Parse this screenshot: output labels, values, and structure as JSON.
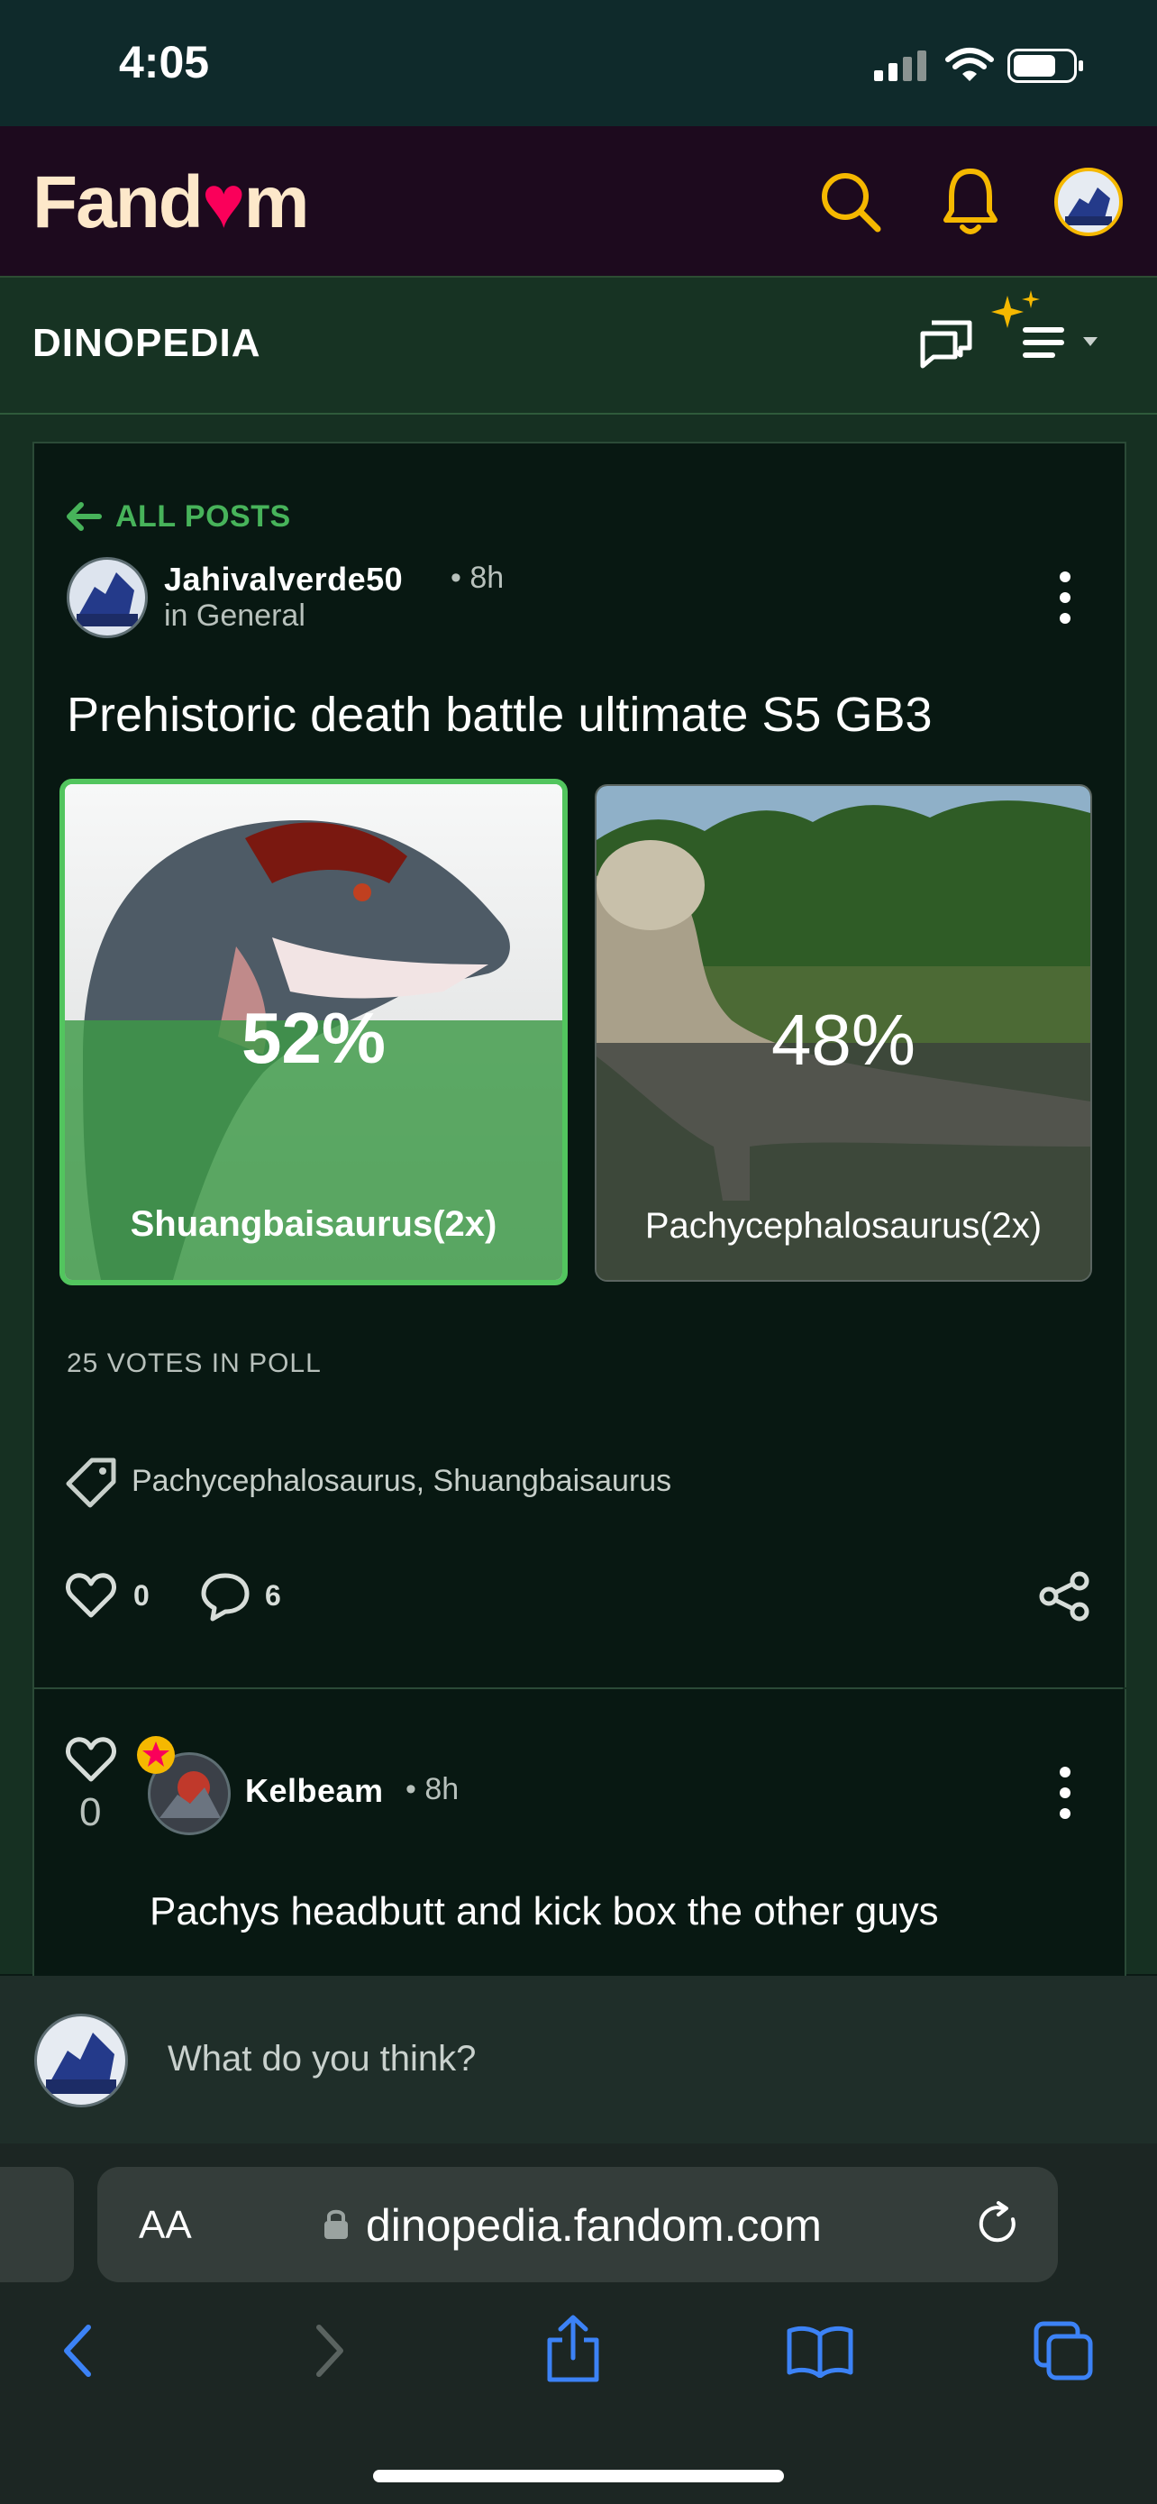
{
  "status_bar": {
    "time": "4:05"
  },
  "header": {
    "logo_text_1": "Fand",
    "logo_text_2": "m"
  },
  "wiki": {
    "name": "DINOPEDIA"
  },
  "post": {
    "back_label": "ALL POSTS",
    "author": "Jahivalverde50",
    "time": "• 8h",
    "category": "in General",
    "title": "Prehistoric death battle ultimate S5 GB3",
    "poll": {
      "options": [
        {
          "label": "Shuangbaisaurus(2x)",
          "percent": "52%",
          "value": 0.52,
          "selected": true
        },
        {
          "label": "Pachycephalosaurus(2x)",
          "percent": "48%",
          "value": 0.48,
          "selected": false
        }
      ],
      "votes_text": "25 VOTES IN POLL"
    },
    "tags": "Pachycephalosaurus, Shuangbaisaurus",
    "likes": "0",
    "comments": "6"
  },
  "comment": {
    "likes": "0",
    "author": "Kelbeam",
    "time": "• 8h",
    "text": "Pachys headbutt and kick box the other guys"
  },
  "composer": {
    "placeholder": "What do you think?"
  },
  "safari": {
    "aa": "AA",
    "url": "dinopedia.fandom.com"
  },
  "icons": [
    "search-icon",
    "bell-icon",
    "discuss-icon",
    "sparkle-menu-icon",
    "back-arrow-icon",
    "more-icon",
    "tag-icon",
    "heart-icon",
    "comment-icon",
    "share-icon",
    "lock-icon",
    "reload-icon",
    "back-icon",
    "forward-icon",
    "share-sheet-icon",
    "bookmarks-icon",
    "tabs-icon"
  ],
  "colors": {
    "accent_green": "#47b35a",
    "fandom_yellow": "#f5b800",
    "fandom_pink": "#fa005a",
    "safari_blue": "#3c82f6"
  }
}
